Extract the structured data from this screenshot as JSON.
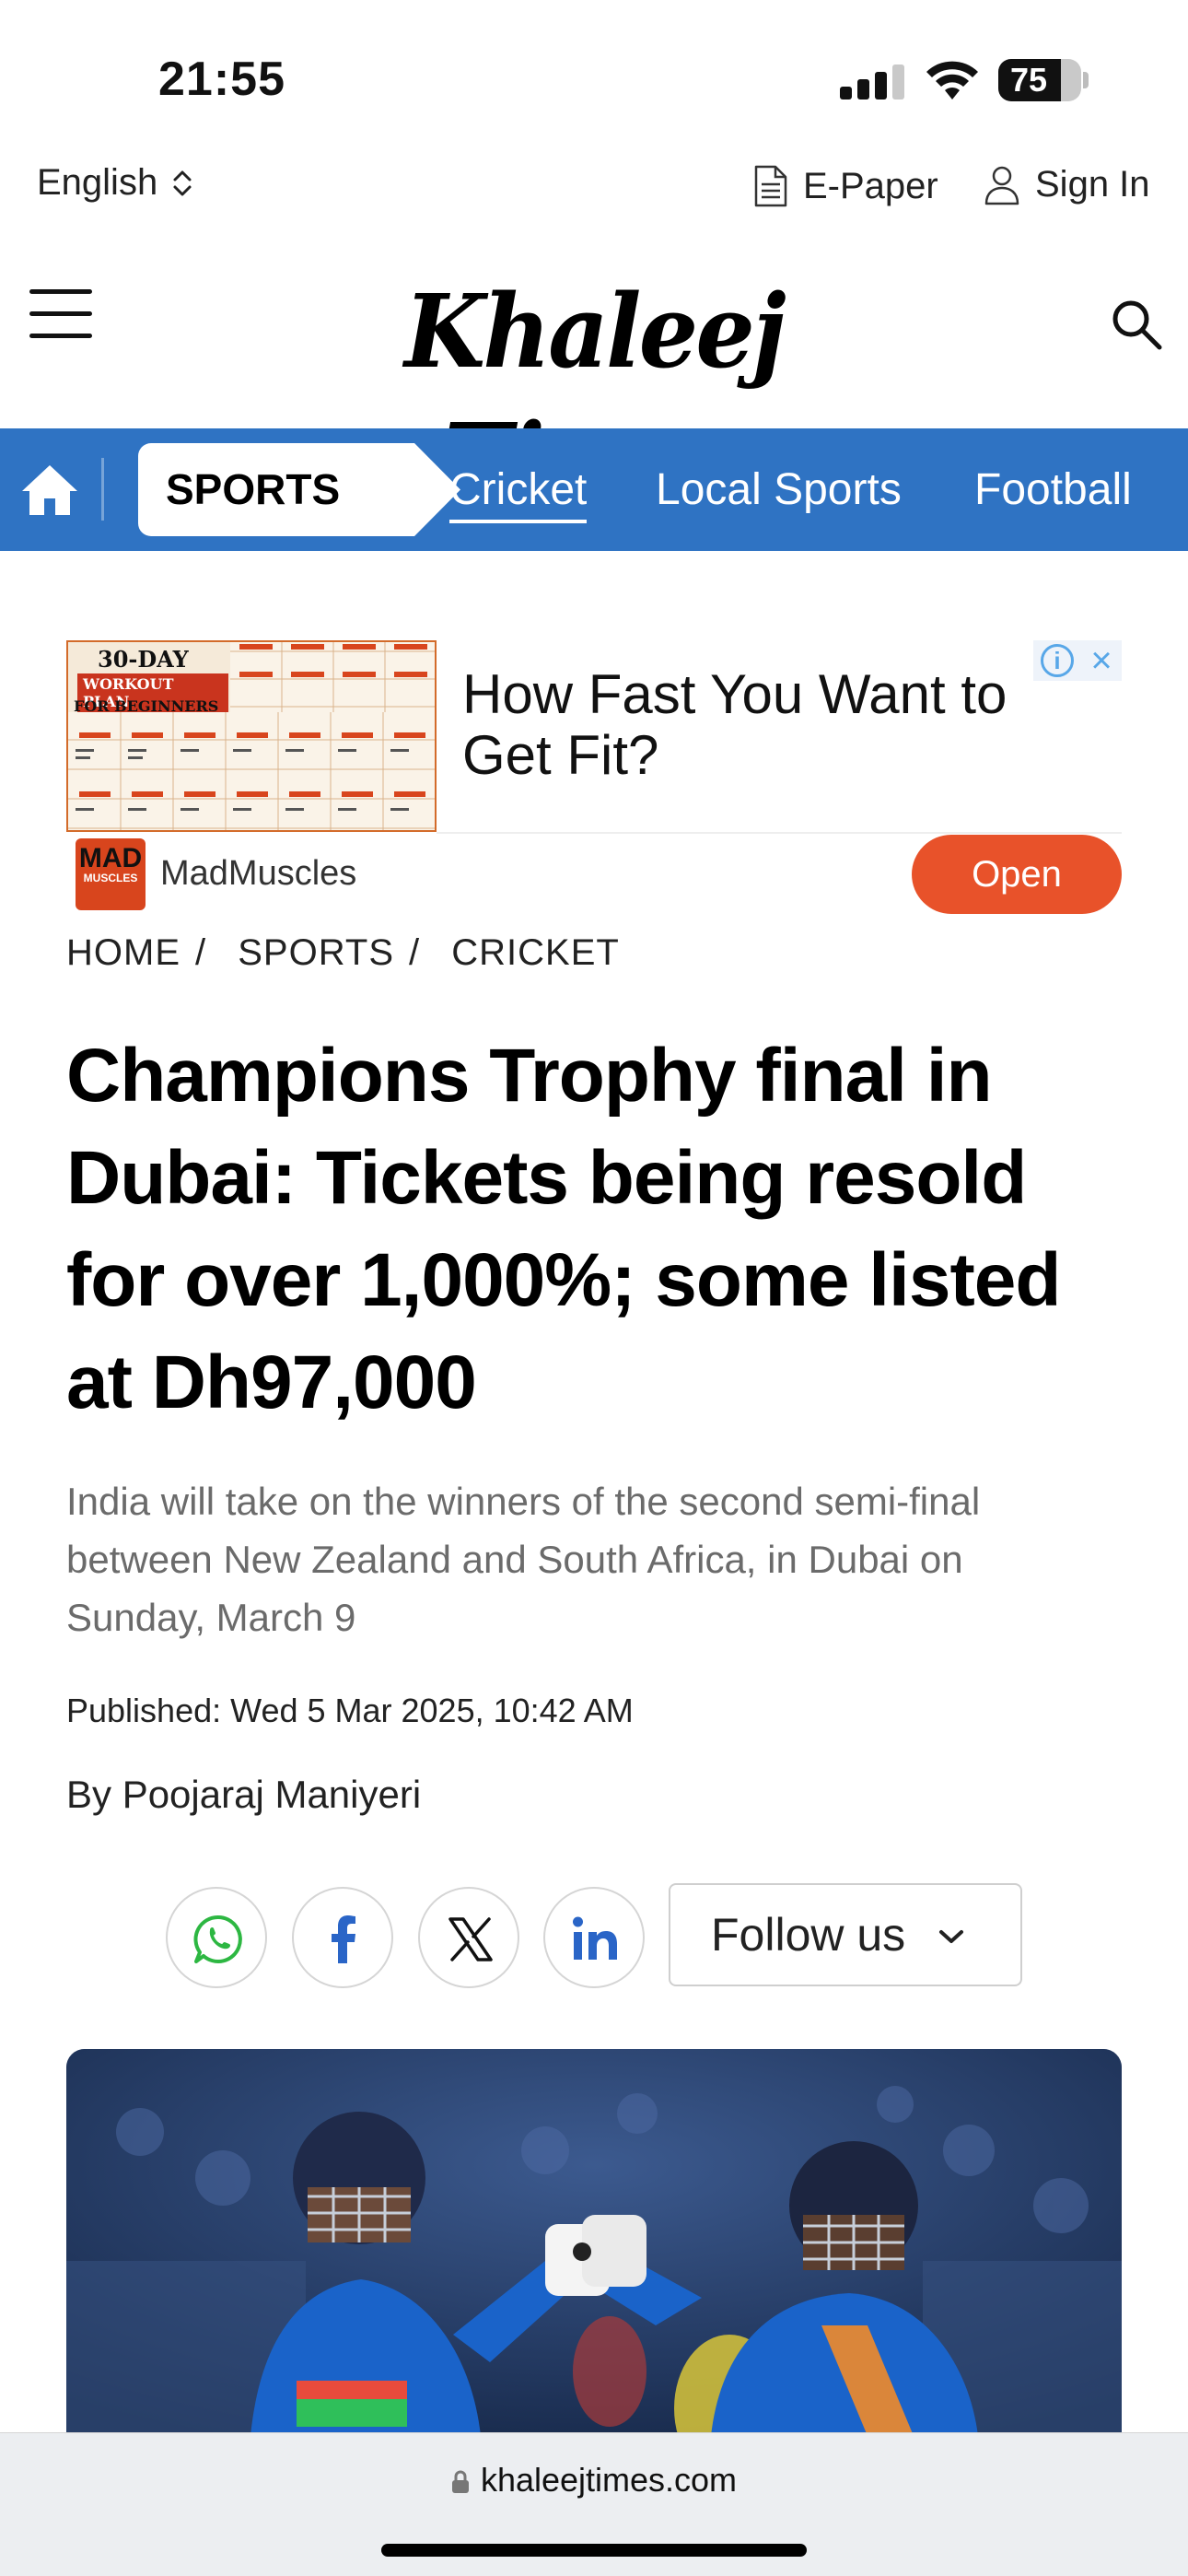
{
  "status_bar": {
    "time": "21:55",
    "battery": "75",
    "battery_level": 0.75
  },
  "top_bar": {
    "language": "English",
    "epaper": "E-Paper",
    "signin": "Sign In"
  },
  "header": {
    "logo": "Khaleej Times"
  },
  "section_nav": {
    "section": "SPORTS",
    "links": [
      {
        "label": "Cricket",
        "active": true
      },
      {
        "label": "Local Sports",
        "active": false
      },
      {
        "label": "Football",
        "active": false
      }
    ],
    "bg_color": "#2f73c3"
  },
  "ad": {
    "thumb_line1": "30-DAY",
    "thumb_line2": "WORKOUT PLAN",
    "thumb_line3": "FOR BEGINNERS",
    "headline": "How Fast You Want to Get Fit?",
    "brand_logo_main": "MAD",
    "brand_logo_sub": "MUSCLES",
    "brand": "MadMuscles",
    "cta": "Open",
    "cta_color": "#e8522a"
  },
  "breadcrumb": [
    "HOME",
    "SPORTS",
    "CRICKET"
  ],
  "article": {
    "headline": "Champions Trophy final in Dubai: Tickets being resold for over 1,000%; some listed at Dh97,000",
    "dek": "India will take on the winners of the second semi-final between New Zealand and South Africa, in Dubai on Sunday, March 9",
    "published": "Published: Wed 5 Mar 2025, 10:42 AM",
    "byline_prefix": "By",
    "author": "Poojaraj Maniyeri"
  },
  "share": {
    "icons": [
      "whatsapp-icon",
      "facebook-icon",
      "x-icon",
      "linkedin-icon"
    ],
    "follow_label": "Follow us"
  },
  "browser": {
    "url": "khaleejtimes.com"
  }
}
